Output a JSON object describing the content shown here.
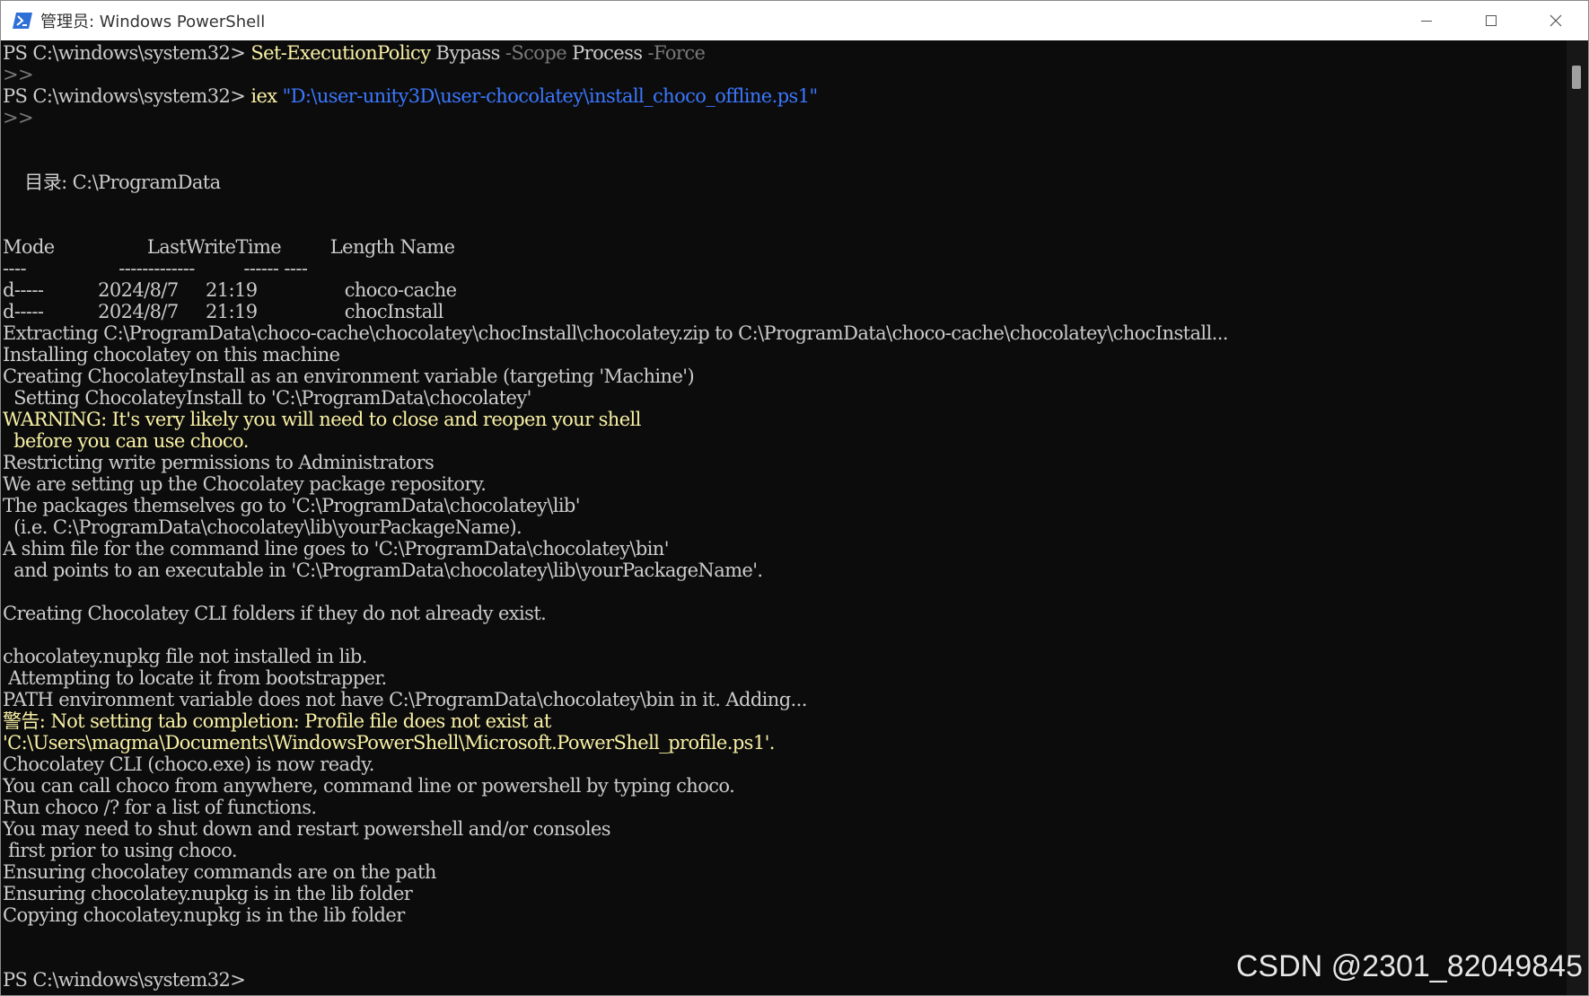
{
  "window": {
    "title": "管理员: Windows PowerShell",
    "icon": "powershell-icon",
    "controls": [
      "minimize-icon",
      "maximize-icon",
      "close-icon"
    ]
  },
  "colors": {
    "background": "#0c0c0c",
    "text": "#cccccc",
    "warning": "#f9f1a5",
    "command": "#f9f1a5",
    "parameter": "#7a7a7a",
    "string": "#3b78ff"
  },
  "console": {
    "prompt1": "PS C:\\windows\\system32> ",
    "cmd1": "Set-ExecutionPolicy",
    "cmd1_arg1": " Bypass ",
    "cmd1_param1": "-Scope",
    "cmd1_arg2": " Process ",
    "cmd1_param2": "-Force",
    "continuation": ">>",
    "prompt2": "PS C:\\windows\\system32> ",
    "cmd2": "iex",
    "cmd2_string": " \"D:\\user-unity3D\\user-chocolatey\\install_choco_offline.ps1\"",
    "dir_header": "    目录: C:\\ProgramData",
    "table_header": "Mode                 LastWriteTime         Length Name",
    "table_underline": "----                 -------------         ------ ----",
    "rows": [
      "d-----          2024/8/7     21:19                choco-cache",
      "d-----          2024/8/7     21:19                chocInstall"
    ],
    "output1": [
      "Extracting C:\\ProgramData\\choco-cache\\chocolatey\\chocInstall\\chocolatey.zip to C:\\ProgramData\\choco-cache\\chocolatey\\chocInstall...",
      "Installing chocolatey on this machine",
      "Creating ChocolateyInstall as an environment variable (targeting 'Machine')",
      "  Setting ChocolateyInstall to 'C:\\ProgramData\\chocolatey'"
    ],
    "warning1": [
      "WARNING: It's very likely you will need to close and reopen your shell",
      "  before you can use choco."
    ],
    "output2": [
      "Restricting write permissions to Administrators",
      "We are setting up the Chocolatey package repository.",
      "The packages themselves go to 'C:\\ProgramData\\chocolatey\\lib'",
      "  (i.e. C:\\ProgramData\\chocolatey\\lib\\yourPackageName).",
      "A shim file for the command line goes to 'C:\\ProgramData\\chocolatey\\bin'",
      "  and points to an executable in 'C:\\ProgramData\\chocolatey\\lib\\yourPackageName'."
    ],
    "output3": "Creating Chocolatey CLI folders if they do not already exist.",
    "output4": [
      "chocolatey.nupkg file not installed in lib.",
      " Attempting to locate it from bootstrapper.",
      "PATH environment variable does not have C:\\ProgramData\\chocolatey\\bin in it. Adding..."
    ],
    "warning2": [
      "警告: Not setting tab completion: Profile file does not exist at",
      "'C:\\Users\\magma\\Documents\\WindowsPowerShell\\Microsoft.PowerShell_profile.ps1'."
    ],
    "output5": [
      "Chocolatey CLI (choco.exe) is now ready.",
      "You can call choco from anywhere, command line or powershell by typing choco.",
      "Run choco /? for a list of functions.",
      "You may need to shut down and restart powershell and/or consoles",
      " first prior to using choco.",
      "Ensuring chocolatey commands are on the path",
      "Ensuring chocolatey.nupkg is in the lib folder",
      "Copying chocolatey.nupkg is in the lib folder"
    ],
    "final_prompt": "PS C:\\windows\\system32> "
  },
  "watermark": "CSDN @2301_82049845"
}
